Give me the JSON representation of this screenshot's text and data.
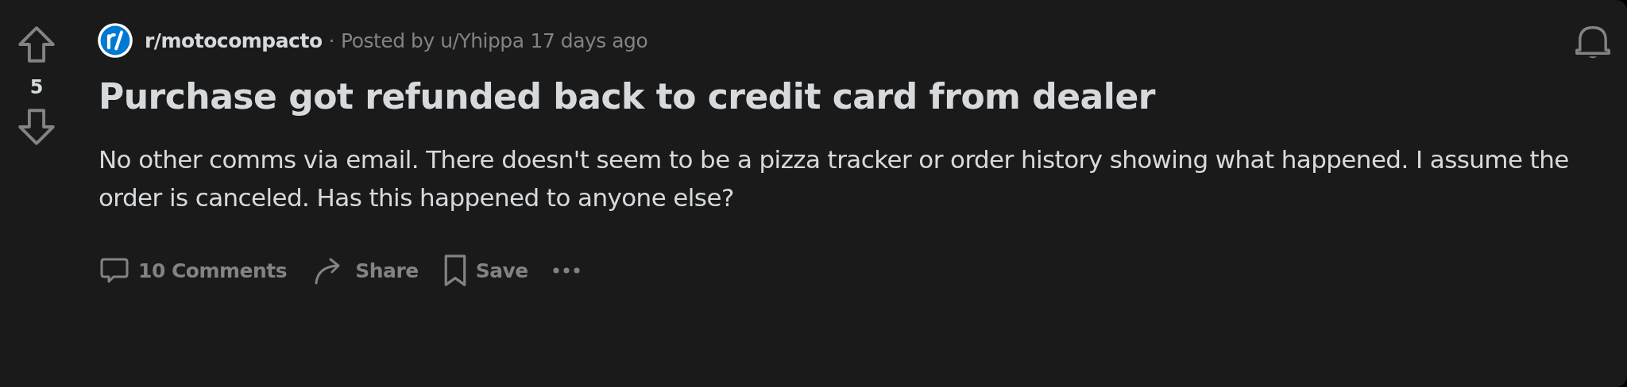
{
  "vote": {
    "score": "5"
  },
  "header": {
    "subreddit": "r/motocompacto",
    "separator": "·",
    "posted_by": "Posted by u/Yhippa",
    "time": "17 days ago"
  },
  "post": {
    "title": "Purchase got refunded back to credit card from dealer",
    "body": "No other comms via email. There doesn't seem to be a pizza tracker or order history showing what happened. I assume the order is canceled. Has this happened to anyone else?"
  },
  "actions": [
    {
      "kind": "comments",
      "label": "10 Comments"
    },
    {
      "kind": "share",
      "label": "Share"
    },
    {
      "kind": "save",
      "label": "Save"
    },
    {
      "kind": "more"
    }
  ]
}
